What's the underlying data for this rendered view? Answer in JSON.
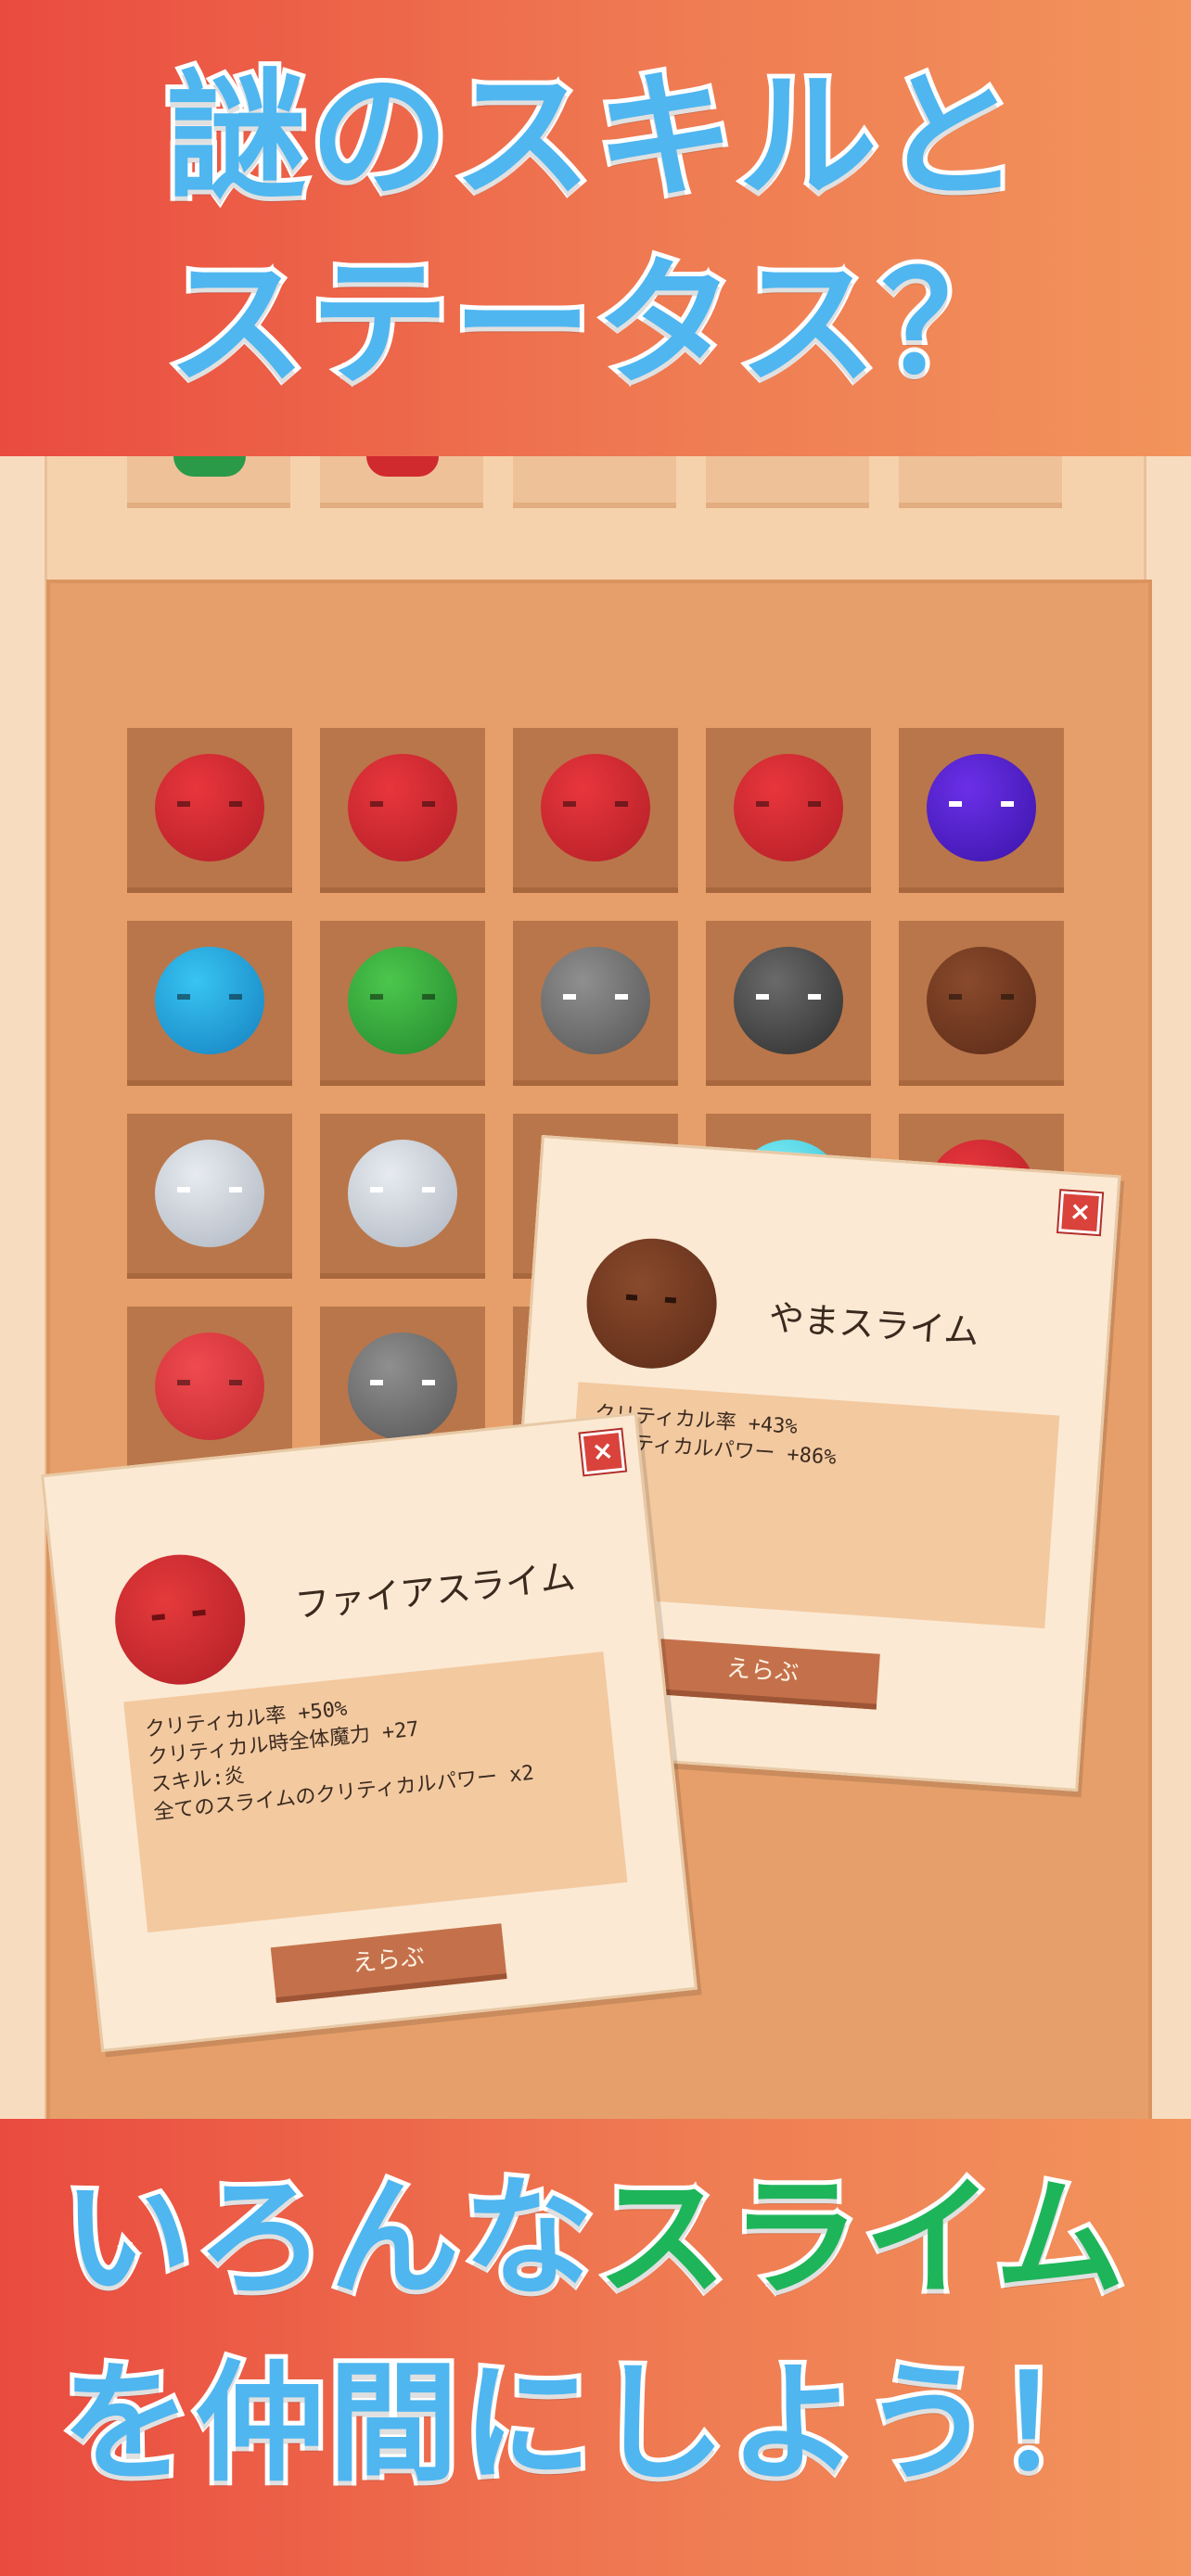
{
  "headline_top": {
    "line1": "謎のスキルと",
    "line2": "ステータス？"
  },
  "headline_bottom": {
    "line1_part1": "いろんな",
    "line1_part2": "スライム",
    "line2": "を仲間にしよう！"
  },
  "colors": {
    "banner_red": "#ea4b3f",
    "banner_orange": "#f2945c",
    "headline_blue": "#4fb6f0",
    "headline_green": "#1eb55a",
    "slot": "#b9764a",
    "panel": "#e69f6a"
  },
  "grid": {
    "rows": [
      [
        "red",
        "red",
        "red",
        "red",
        "purple"
      ],
      [
        "blue",
        "green",
        "gray",
        "dark-gray",
        "brown"
      ],
      [
        "white",
        "white",
        "hidden",
        "cyan",
        "red"
      ],
      [
        "pink-red",
        "gray",
        "hidden",
        "hidden",
        "hidden"
      ]
    ]
  },
  "cards": [
    {
      "name": "やまスライム",
      "slime": "brown",
      "stats": [
        "クリティカル率 +43%",
        "クリティカルパワー +86%"
      ],
      "button": "えらぶ",
      "close": "×"
    },
    {
      "name": "ファイアスライム",
      "slime": "red",
      "stats": [
        "クリティカル率 +50%",
        "クリティカル時全体魔力 +27",
        "",
        "スキル:炎",
        "全てのスライムのクリティカルパワー x2"
      ],
      "button": "えらぶ",
      "close": "×"
    }
  ]
}
